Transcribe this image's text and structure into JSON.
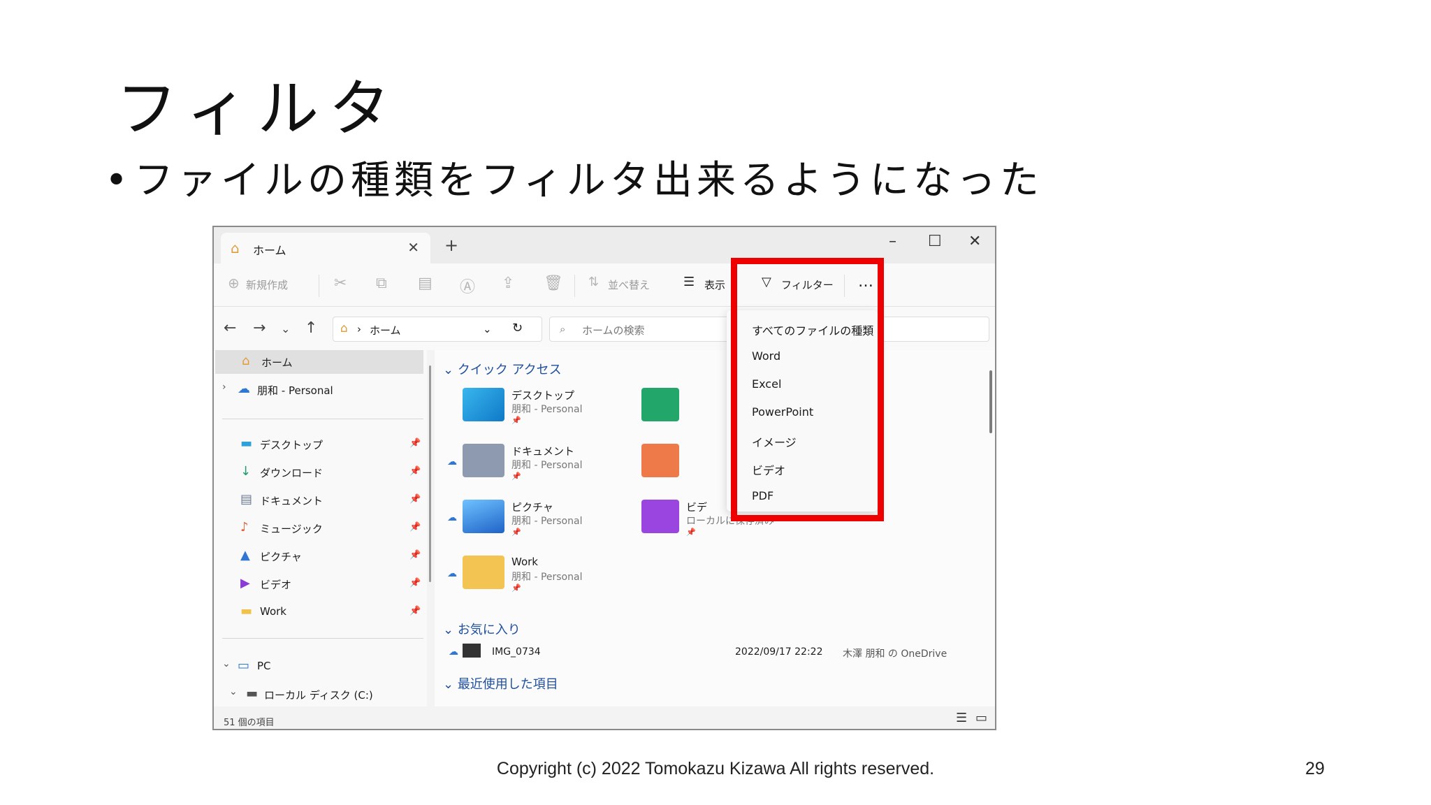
{
  "slide": {
    "title": "フィルタ",
    "bullet": "ファイルの種類をフィルタ出来るようになった",
    "copyright": "Copyright (c) 2022 Tomokazu Kizawa All rights reserved.",
    "page_number": "29"
  },
  "explorer": {
    "tab_label": "ホーム",
    "toolbar": {
      "new": "新規作成",
      "sort": "並べ替え",
      "view": "表示",
      "filter": "フィルター",
      "more": "…"
    },
    "address": {
      "crumb": "ホーム",
      "search_placeholder": "ホームの検索"
    },
    "sidebar": {
      "home": "ホーム",
      "onedrive": "朋和 - Personal",
      "items": [
        "デスクトップ",
        "ダウンロード",
        "ドキュメント",
        "ミュージック",
        "ピクチャ",
        "ビデオ",
        "Work"
      ],
      "pc": "PC",
      "drive": "ローカル ディスク (C:)"
    },
    "quick_access": {
      "header": "クイック アクセス",
      "items": [
        {
          "name": "デスクトップ",
          "sub": "朋和 - Personal"
        },
        {
          "name": "ドキュメント",
          "sub": "朋和 - Personal"
        },
        {
          "name": "ピクチャ",
          "sub": "朋和 - Personal"
        },
        {
          "name": "Work",
          "sub": "朋和 - Personal"
        },
        {
          "name": "ビデ",
          "sub": "ローカルに保存済み"
        }
      ]
    },
    "favorites": {
      "header": "お気に入り",
      "file": "IMG_0734",
      "date": "2022/09/17 22:22",
      "location": "木澤 朋和 の OneDrive"
    },
    "recent": {
      "header": "最近使用した項目"
    },
    "status": {
      "count": "51 個の項目"
    },
    "filter_menu": [
      "すべてのファイルの種類",
      "Word",
      "Excel",
      "PowerPoint",
      "イメージ",
      "ビデオ",
      "PDF"
    ],
    "colors": {
      "highlight": "#ee0000",
      "link_blue": "#1f4f9e"
    }
  }
}
